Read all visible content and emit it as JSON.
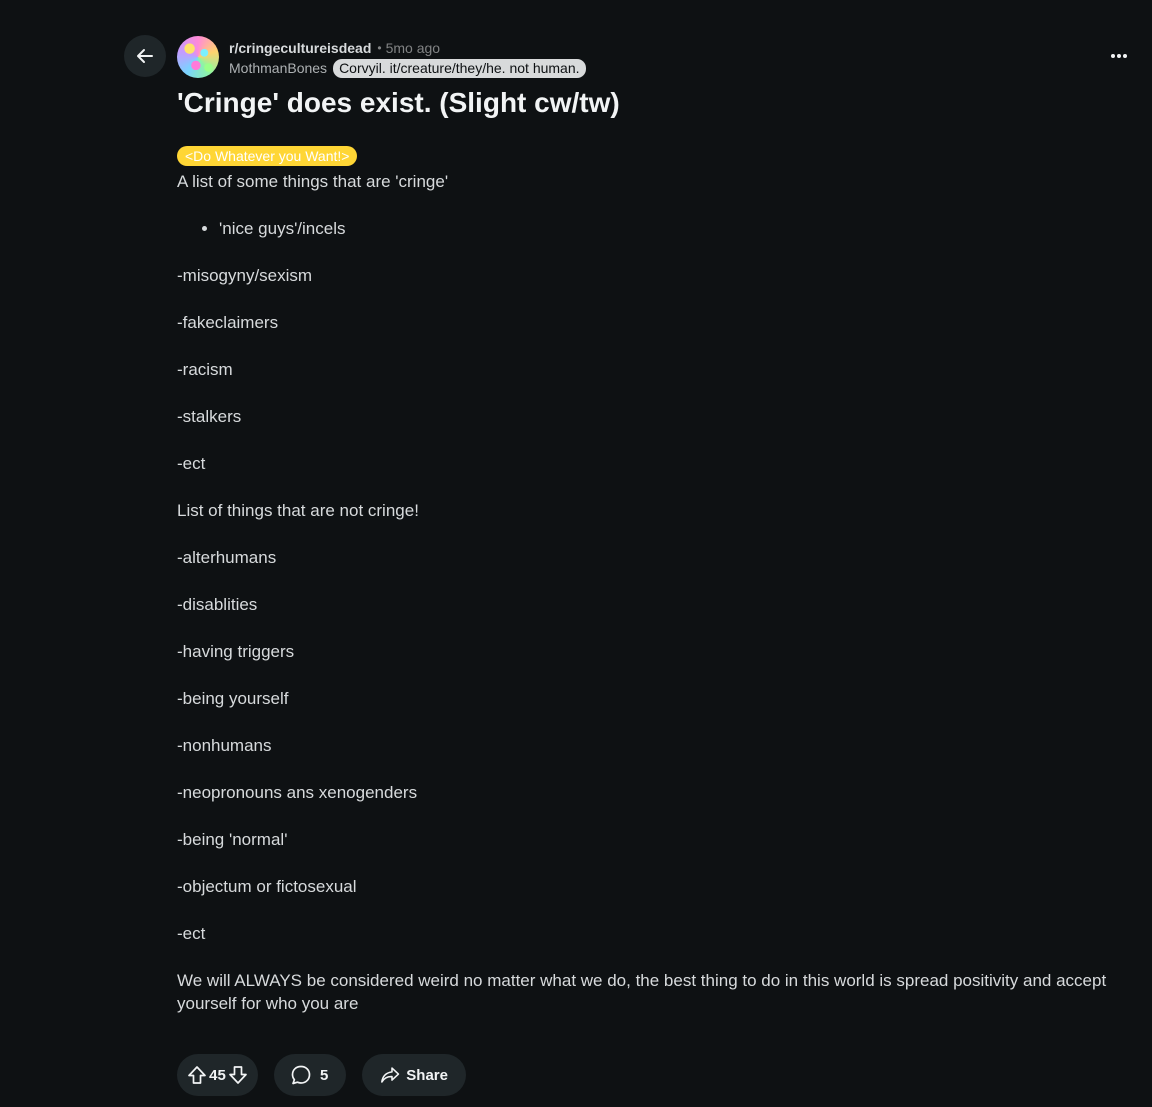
{
  "header": {
    "subreddit": "r/cringecultureisdead",
    "separator": "•",
    "time_ago": "5mo ago",
    "username": "MothmanBones",
    "user_flair": "Corvyil. it/creature/they/he. not human."
  },
  "post": {
    "title": "'Cringe' does exist. (Slight cw/tw)",
    "flair": "<Do Whatever you Want!>",
    "flair_color": "#ffd635",
    "intro": "A list of some things that are 'cringe'",
    "bullet_item": "'nice guys'/incels",
    "cringe_items": [
      "-misogyny/sexism",
      "-fakeclaimers",
      "-racism",
      "-stalkers",
      "-ect"
    ],
    "not_cringe_heading": "List of things that are not cringe!",
    "not_cringe_items": [
      "-alterhumans",
      "-disablities",
      "-having triggers",
      "-being yourself",
      "-nonhumans",
      "-neopronouns ans xenogenders",
      "-being 'normal'",
      "-objectum or fictosexual",
      "-ect"
    ],
    "closing": "We will ALWAYS be considered weird no matter what we do, the best thing to do in this world is spread positivity and accept yourself for who you are"
  },
  "actions": {
    "vote_count": "45",
    "comment_count": "5",
    "share_label": "Share"
  },
  "icons": {
    "back": "arrow-left-icon",
    "more": "ellipsis-icon",
    "upvote": "upvote-arrow-icon",
    "downvote": "downvote-arrow-icon",
    "comment": "speech-bubble-icon",
    "share": "share-arrow-icon"
  }
}
